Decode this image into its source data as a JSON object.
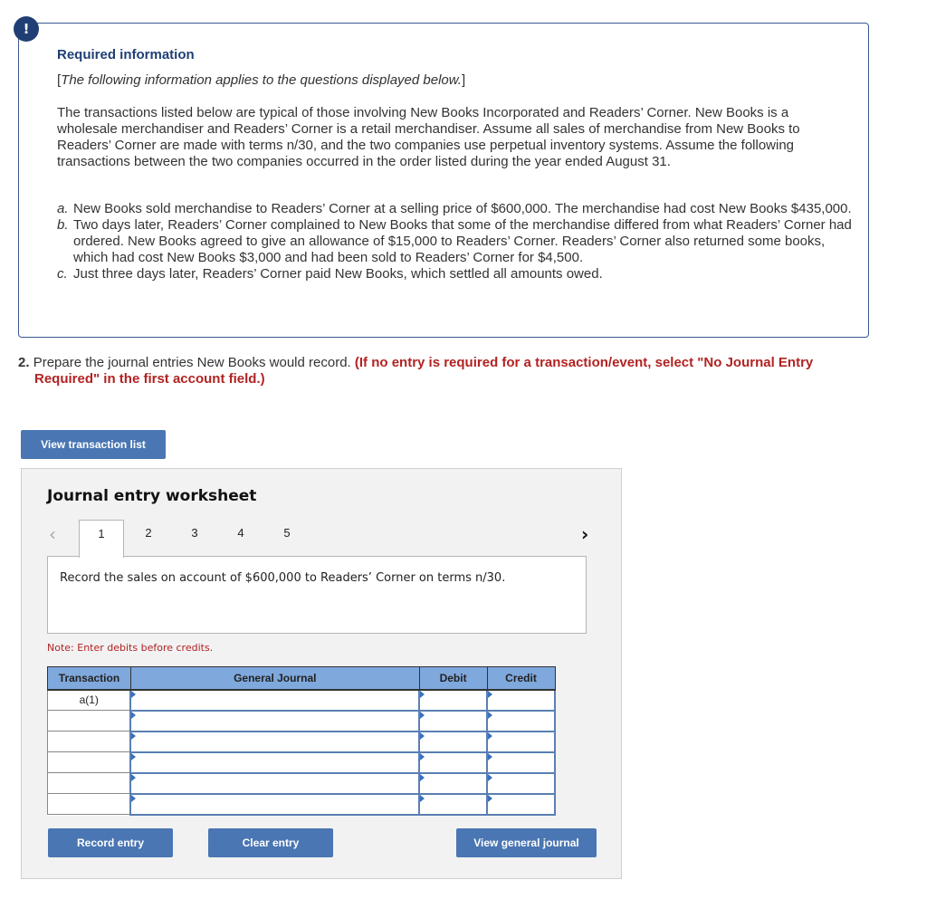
{
  "info": {
    "badge_icon": "!",
    "title": "Required information",
    "subtitle": "The following information applies to the questions displayed below.",
    "paragraph": "The transactions listed below are typical of those involving New Books Incorporated and Readers’ Corner. New Books is a wholesale merchandiser and Readers’ Corner is a retail merchandiser. Assume all sales of merchandise from New Books to Readers’ Corner are made with terms n/30, and the two companies use perpetual inventory systems. Assume the following transactions between the two companies occurred in the order listed during the year ended August 31.",
    "items": [
      {
        "letter": "a.",
        "text": "New Books sold merchandise to Readers’ Corner at a selling price of $600,000. The merchandise had cost New Books $435,000."
      },
      {
        "letter": "b.",
        "text": "Two days later, Readers’ Corner complained to New Books that some of the merchandise differed from what Readers’ Corner had ordered. New Books agreed to give an allowance of $15,000 to Readers’ Corner. Readers’ Corner also returned some books, which had cost New Books $3,000 and had been sold to Readers’ Corner for $4,500."
      },
      {
        "letter": "c.",
        "text": "Just three days later, Readers’ Corner paid New Books, which settled all amounts owed."
      }
    ]
  },
  "question": {
    "number": "2.",
    "text": "Prepare the journal entries New Books would record.",
    "instruction": "(If no entry is required for a transaction/event, select \"No Journal Entry Required\" in the first account field.)"
  },
  "buttons": {
    "view_transaction_list": "View transaction list",
    "record_entry": "Record entry",
    "clear_entry": "Clear entry",
    "view_general_journal": "View general journal"
  },
  "worksheet": {
    "title": "Journal entry worksheet",
    "prev_icon": "‹",
    "next_icon": "›",
    "tabs": [
      "1",
      "2",
      "3",
      "4",
      "5"
    ],
    "active_tab": "1",
    "prompt": "Record the sales on account of $600,000 to Readers’ Corner on terms n/30.",
    "note": "Note: Enter debits before credits.",
    "table": {
      "headers": [
        "Transaction",
        "General Journal",
        "Debit",
        "Credit"
      ],
      "rows": [
        {
          "transaction": "a(1)",
          "account": "",
          "debit": "",
          "credit": ""
        },
        {
          "transaction": "",
          "account": "",
          "debit": "",
          "credit": ""
        },
        {
          "transaction": "",
          "account": "",
          "debit": "",
          "credit": ""
        },
        {
          "transaction": "",
          "account": "",
          "debit": "",
          "credit": ""
        },
        {
          "transaction": "",
          "account": "",
          "debit": "",
          "credit": ""
        },
        {
          "transaction": "",
          "account": "",
          "debit": "",
          "credit": ""
        }
      ]
    }
  }
}
